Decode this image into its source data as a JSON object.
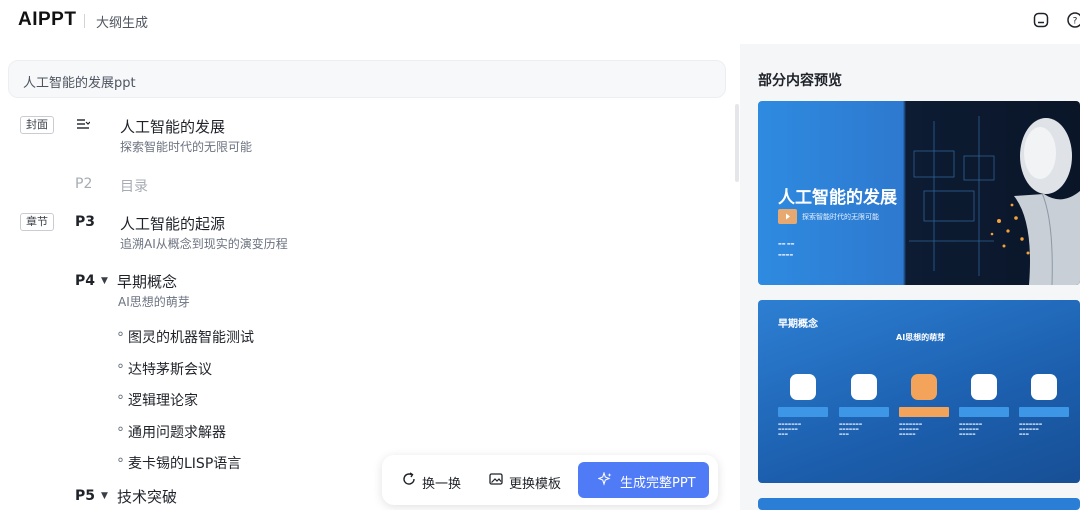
{
  "app": {
    "logo": "AIPPT",
    "subtitle": "大纲生成"
  },
  "prompt": {
    "value": "人工智能的发展ppt"
  },
  "outline": {
    "cover": {
      "tag": "封面",
      "title": "人工智能的发展",
      "desc": "探索智能时代的无限可能"
    },
    "p2": {
      "num": "P2",
      "title": "目录"
    },
    "p3": {
      "tag": "章节",
      "num": "P3",
      "title": "人工智能的起源",
      "desc": "追溯AI从概念到现实的演变历程"
    },
    "p4": {
      "num": "P4",
      "title": "早期概念",
      "desc": "AI思想的萌芽",
      "bullets": [
        "图灵的机器智能测试",
        "达特茅斯会议",
        "逻辑理论家",
        "通用问题求解器",
        "麦卡锡的LISP语言"
      ]
    },
    "p5": {
      "num": "P5",
      "title": "技术突破"
    }
  },
  "actions": {
    "shuffle": "换一换",
    "change_template": "更换模板",
    "generate": "生成完整PPT"
  },
  "preview": {
    "heading": "部分内容预览",
    "slide1": {
      "title": "人工智能的发展",
      "subtitle": "探索智能时代的无限可能"
    },
    "slide2": {
      "heading": "早期概念",
      "subtitle": "AI思想的萌芽"
    }
  },
  "colors": {
    "accent": "#4f7bf7",
    "slide_blue": "#2d7fd3",
    "highlight_orange": "#f3a45a"
  }
}
